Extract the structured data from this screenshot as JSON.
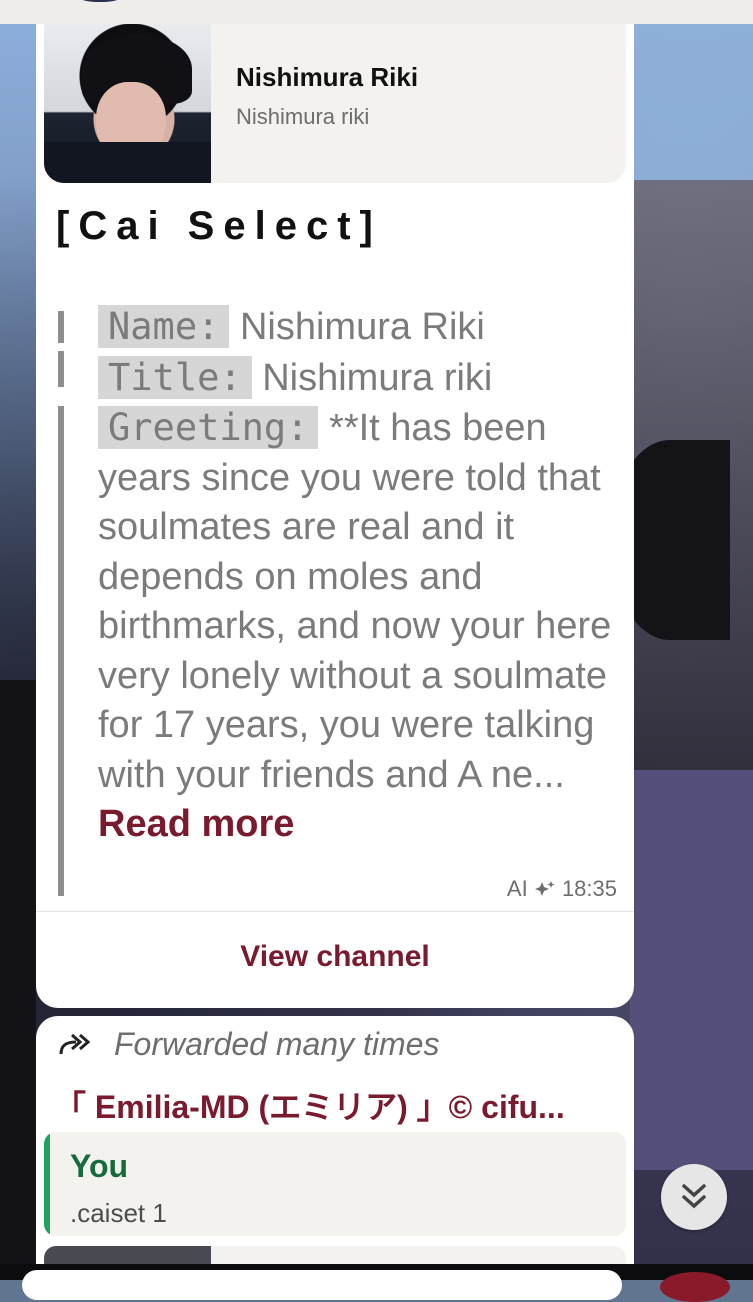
{
  "channel_card": {
    "name": "Nishimura Riki",
    "subtitle": "Nishimura riki"
  },
  "message1": {
    "heading": "[Cai Select]",
    "fields": {
      "name_key": "Name:",
      "name_value": "Nishimura Riki",
      "title_key": "Title:",
      "title_value": "Nishimura riki",
      "greeting_key": "Greeting:",
      "greeting_value": "**It has been years since you were told that soulmates are real and it depends on moles and birthmarks, and now your here very lonely without a soulmate for 17 years, you were talking with your friends and A ne..."
    },
    "read_more": "Read more",
    "ai_label": "AI",
    "time": "18:35",
    "view_channel": "View channel"
  },
  "message2": {
    "forwarded": "Forwarded many times",
    "from": "「 Emilia-MD (エミリア) 」© cifu...",
    "reply_name": "You",
    "reply_text": ".caiset 1"
  },
  "icons": {
    "forward": "forward-double-arrow-icon",
    "ai": "ai-sparkle-icon",
    "scroll": "chevrons-down-icon"
  },
  "colors": {
    "accent": "#7a1a2e",
    "reply_bar": "#20a35b",
    "reply_name": "#166b3c"
  }
}
